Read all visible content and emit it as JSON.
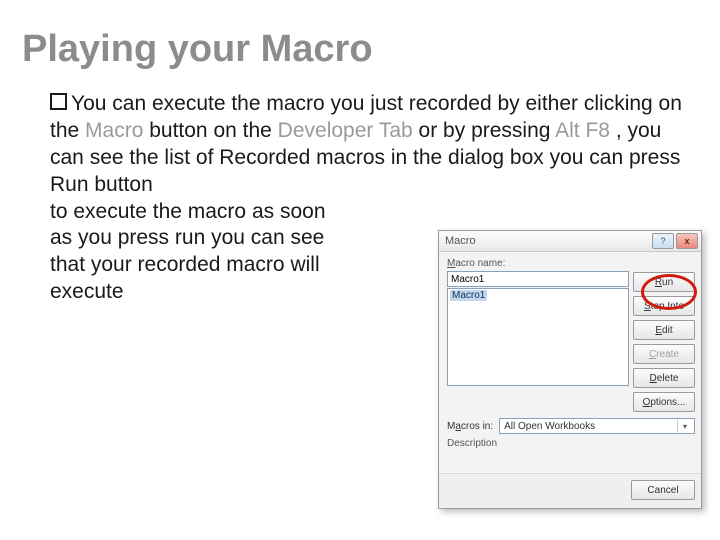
{
  "title": "Playing your Macro",
  "body": {
    "t1": "You can execute the macro you just recorded by either clicking on the ",
    "macro_word": "Macro",
    "t2": " button on the ",
    "devtab_word": "Developer Tab",
    "t3": " or by pressing ",
    "altf8_word": "Alt F8",
    "t4": " , you can see the list of Recorded macros in the dialog box you can press Run button",
    "line5": "to execute the macro as soon",
    "line6": "as you press run you can see",
    "line7": "that your recorded macro will",
    "line8": "execute"
  },
  "dialog": {
    "title": "Macro",
    "help_glyph": "?",
    "close_glyph": "x",
    "name_label": "Macro name:",
    "name_value": "Macro1",
    "list_item": "Macro1",
    "buttons": {
      "run": "Run",
      "step": "Step Into",
      "edit": "Edit",
      "create": "Create",
      "delete": "Delete",
      "options": "Options..."
    },
    "macros_in_label": "Macros in:",
    "macros_in_value": "All Open Workbooks",
    "desc_label": "Description",
    "cancel": "Cancel"
  }
}
